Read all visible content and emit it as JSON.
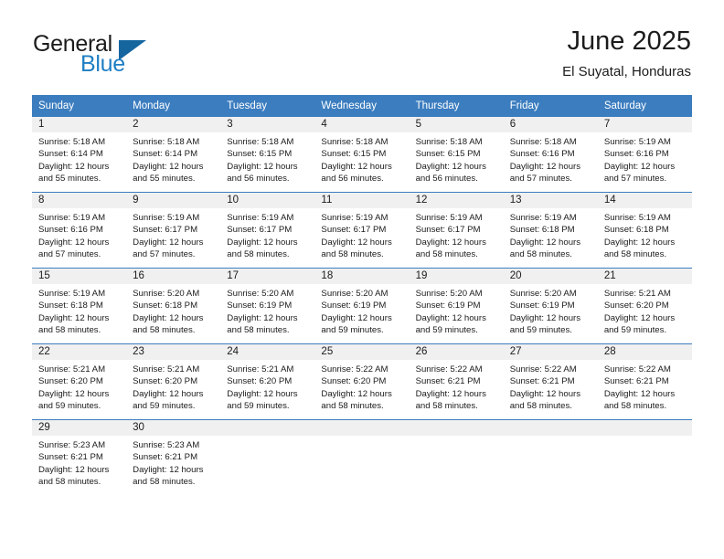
{
  "brand": {
    "name_top": "General",
    "name_bottom": "Blue",
    "accent_color": "#1f7fc4",
    "triangle_color": "#15659f",
    "logo_icon": "blue-triangle-icon"
  },
  "header": {
    "title": "June 2025",
    "subtitle": "El Suyatal, Honduras"
  },
  "theme": {
    "header_row_bg": "#3b7dbf",
    "daynum_band_bg": "#f0f0f0",
    "cell_bg": "#ffffff",
    "text_color": "#1b1b1b",
    "week_divider": "#3b7dbf"
  },
  "calendar": {
    "weekday_headers": [
      "Sunday",
      "Monday",
      "Tuesday",
      "Wednesday",
      "Thursday",
      "Friday",
      "Saturday"
    ],
    "labels": {
      "sunrise": "Sunrise:",
      "sunset": "Sunset:",
      "daylight": "Daylight:"
    },
    "weeks": [
      [
        {
          "day": "1",
          "sunrise": "Sunrise: 5:18 AM",
          "sunset": "Sunset: 6:14 PM",
          "daylight_1": "Daylight: 12 hours",
          "daylight_2": "and 55 minutes."
        },
        {
          "day": "2",
          "sunrise": "Sunrise: 5:18 AM",
          "sunset": "Sunset: 6:14 PM",
          "daylight_1": "Daylight: 12 hours",
          "daylight_2": "and 55 minutes."
        },
        {
          "day": "3",
          "sunrise": "Sunrise: 5:18 AM",
          "sunset": "Sunset: 6:15 PM",
          "daylight_1": "Daylight: 12 hours",
          "daylight_2": "and 56 minutes."
        },
        {
          "day": "4",
          "sunrise": "Sunrise: 5:18 AM",
          "sunset": "Sunset: 6:15 PM",
          "daylight_1": "Daylight: 12 hours",
          "daylight_2": "and 56 minutes."
        },
        {
          "day": "5",
          "sunrise": "Sunrise: 5:18 AM",
          "sunset": "Sunset: 6:15 PM",
          "daylight_1": "Daylight: 12 hours",
          "daylight_2": "and 56 minutes."
        },
        {
          "day": "6",
          "sunrise": "Sunrise: 5:18 AM",
          "sunset": "Sunset: 6:16 PM",
          "daylight_1": "Daylight: 12 hours",
          "daylight_2": "and 57 minutes."
        },
        {
          "day": "7",
          "sunrise": "Sunrise: 5:19 AM",
          "sunset": "Sunset: 6:16 PM",
          "daylight_1": "Daylight: 12 hours",
          "daylight_2": "and 57 minutes."
        }
      ],
      [
        {
          "day": "8",
          "sunrise": "Sunrise: 5:19 AM",
          "sunset": "Sunset: 6:16 PM",
          "daylight_1": "Daylight: 12 hours",
          "daylight_2": "and 57 minutes."
        },
        {
          "day": "9",
          "sunrise": "Sunrise: 5:19 AM",
          "sunset": "Sunset: 6:17 PM",
          "daylight_1": "Daylight: 12 hours",
          "daylight_2": "and 57 minutes."
        },
        {
          "day": "10",
          "sunrise": "Sunrise: 5:19 AM",
          "sunset": "Sunset: 6:17 PM",
          "daylight_1": "Daylight: 12 hours",
          "daylight_2": "and 58 minutes."
        },
        {
          "day": "11",
          "sunrise": "Sunrise: 5:19 AM",
          "sunset": "Sunset: 6:17 PM",
          "daylight_1": "Daylight: 12 hours",
          "daylight_2": "and 58 minutes."
        },
        {
          "day": "12",
          "sunrise": "Sunrise: 5:19 AM",
          "sunset": "Sunset: 6:17 PM",
          "daylight_1": "Daylight: 12 hours",
          "daylight_2": "and 58 minutes."
        },
        {
          "day": "13",
          "sunrise": "Sunrise: 5:19 AM",
          "sunset": "Sunset: 6:18 PM",
          "daylight_1": "Daylight: 12 hours",
          "daylight_2": "and 58 minutes."
        },
        {
          "day": "14",
          "sunrise": "Sunrise: 5:19 AM",
          "sunset": "Sunset: 6:18 PM",
          "daylight_1": "Daylight: 12 hours",
          "daylight_2": "and 58 minutes."
        }
      ],
      [
        {
          "day": "15",
          "sunrise": "Sunrise: 5:19 AM",
          "sunset": "Sunset: 6:18 PM",
          "daylight_1": "Daylight: 12 hours",
          "daylight_2": "and 58 minutes."
        },
        {
          "day": "16",
          "sunrise": "Sunrise: 5:20 AM",
          "sunset": "Sunset: 6:18 PM",
          "daylight_1": "Daylight: 12 hours",
          "daylight_2": "and 58 minutes."
        },
        {
          "day": "17",
          "sunrise": "Sunrise: 5:20 AM",
          "sunset": "Sunset: 6:19 PM",
          "daylight_1": "Daylight: 12 hours",
          "daylight_2": "and 58 minutes."
        },
        {
          "day": "18",
          "sunrise": "Sunrise: 5:20 AM",
          "sunset": "Sunset: 6:19 PM",
          "daylight_1": "Daylight: 12 hours",
          "daylight_2": "and 59 minutes."
        },
        {
          "day": "19",
          "sunrise": "Sunrise: 5:20 AM",
          "sunset": "Sunset: 6:19 PM",
          "daylight_1": "Daylight: 12 hours",
          "daylight_2": "and 59 minutes."
        },
        {
          "day": "20",
          "sunrise": "Sunrise: 5:20 AM",
          "sunset": "Sunset: 6:19 PM",
          "daylight_1": "Daylight: 12 hours",
          "daylight_2": "and 59 minutes."
        },
        {
          "day": "21",
          "sunrise": "Sunrise: 5:21 AM",
          "sunset": "Sunset: 6:20 PM",
          "daylight_1": "Daylight: 12 hours",
          "daylight_2": "and 59 minutes."
        }
      ],
      [
        {
          "day": "22",
          "sunrise": "Sunrise: 5:21 AM",
          "sunset": "Sunset: 6:20 PM",
          "daylight_1": "Daylight: 12 hours",
          "daylight_2": "and 59 minutes."
        },
        {
          "day": "23",
          "sunrise": "Sunrise: 5:21 AM",
          "sunset": "Sunset: 6:20 PM",
          "daylight_1": "Daylight: 12 hours",
          "daylight_2": "and 59 minutes."
        },
        {
          "day": "24",
          "sunrise": "Sunrise: 5:21 AM",
          "sunset": "Sunset: 6:20 PM",
          "daylight_1": "Daylight: 12 hours",
          "daylight_2": "and 59 minutes."
        },
        {
          "day": "25",
          "sunrise": "Sunrise: 5:22 AM",
          "sunset": "Sunset: 6:20 PM",
          "daylight_1": "Daylight: 12 hours",
          "daylight_2": "and 58 minutes."
        },
        {
          "day": "26",
          "sunrise": "Sunrise: 5:22 AM",
          "sunset": "Sunset: 6:21 PM",
          "daylight_1": "Daylight: 12 hours",
          "daylight_2": "and 58 minutes."
        },
        {
          "day": "27",
          "sunrise": "Sunrise: 5:22 AM",
          "sunset": "Sunset: 6:21 PM",
          "daylight_1": "Daylight: 12 hours",
          "daylight_2": "and 58 minutes."
        },
        {
          "day": "28",
          "sunrise": "Sunrise: 5:22 AM",
          "sunset": "Sunset: 6:21 PM",
          "daylight_1": "Daylight: 12 hours",
          "daylight_2": "and 58 minutes."
        }
      ],
      [
        {
          "day": "29",
          "sunrise": "Sunrise: 5:23 AM",
          "sunset": "Sunset: 6:21 PM",
          "daylight_1": "Daylight: 12 hours",
          "daylight_2": "and 58 minutes."
        },
        {
          "day": "30",
          "sunrise": "Sunrise: 5:23 AM",
          "sunset": "Sunset: 6:21 PM",
          "daylight_1": "Daylight: 12 hours",
          "daylight_2": "and 58 minutes."
        },
        {
          "day": "",
          "sunrise": "",
          "sunset": "",
          "daylight_1": "",
          "daylight_2": ""
        },
        {
          "day": "",
          "sunrise": "",
          "sunset": "",
          "daylight_1": "",
          "daylight_2": ""
        },
        {
          "day": "",
          "sunrise": "",
          "sunset": "",
          "daylight_1": "",
          "daylight_2": ""
        },
        {
          "day": "",
          "sunrise": "",
          "sunset": "",
          "daylight_1": "",
          "daylight_2": ""
        },
        {
          "day": "",
          "sunrise": "",
          "sunset": "",
          "daylight_1": "",
          "daylight_2": ""
        }
      ]
    ]
  }
}
